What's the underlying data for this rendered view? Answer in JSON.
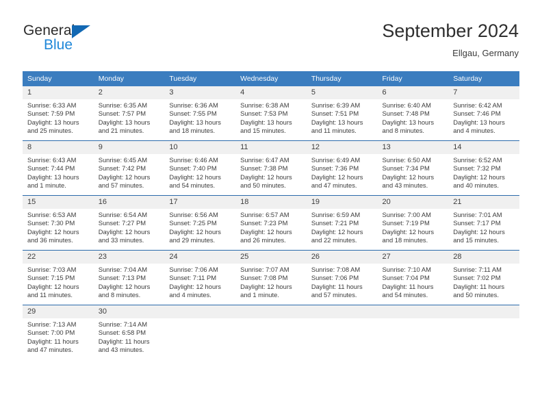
{
  "brand": {
    "name_part1": "General",
    "name_part2": "Blue",
    "triangle_color": "#1268b3",
    "blue_text_color": "#1f87d8"
  },
  "header": {
    "title": "September 2024",
    "location": "Ellgau, Germany"
  },
  "theme": {
    "header_blue": "#3b7dbf",
    "row_divider": "#2a6aab",
    "daynum_band": "#f0f0f0"
  },
  "weekdays": [
    "Sunday",
    "Monday",
    "Tuesday",
    "Wednesday",
    "Thursday",
    "Friday",
    "Saturday"
  ],
  "labels": {
    "sunrise_prefix": "Sunrise:",
    "sunset_prefix": "Sunset:",
    "daylight_prefix": "Daylight:"
  },
  "weeks": [
    [
      {
        "day": "1",
        "sunrise": "Sunrise: 6:33 AM",
        "sunset": "Sunset: 7:59 PM",
        "daylight_line1": "Daylight: 13 hours",
        "daylight_line2": "and 25 minutes."
      },
      {
        "day": "2",
        "sunrise": "Sunrise: 6:35 AM",
        "sunset": "Sunset: 7:57 PM",
        "daylight_line1": "Daylight: 13 hours",
        "daylight_line2": "and 21 minutes."
      },
      {
        "day": "3",
        "sunrise": "Sunrise: 6:36 AM",
        "sunset": "Sunset: 7:55 PM",
        "daylight_line1": "Daylight: 13 hours",
        "daylight_line2": "and 18 minutes."
      },
      {
        "day": "4",
        "sunrise": "Sunrise: 6:38 AM",
        "sunset": "Sunset: 7:53 PM",
        "daylight_line1": "Daylight: 13 hours",
        "daylight_line2": "and 15 minutes."
      },
      {
        "day": "5",
        "sunrise": "Sunrise: 6:39 AM",
        "sunset": "Sunset: 7:51 PM",
        "daylight_line1": "Daylight: 13 hours",
        "daylight_line2": "and 11 minutes."
      },
      {
        "day": "6",
        "sunrise": "Sunrise: 6:40 AM",
        "sunset": "Sunset: 7:48 PM",
        "daylight_line1": "Daylight: 13 hours",
        "daylight_line2": "and 8 minutes."
      },
      {
        "day": "7",
        "sunrise": "Sunrise: 6:42 AM",
        "sunset": "Sunset: 7:46 PM",
        "daylight_line1": "Daylight: 13 hours",
        "daylight_line2": "and 4 minutes."
      }
    ],
    [
      {
        "day": "8",
        "sunrise": "Sunrise: 6:43 AM",
        "sunset": "Sunset: 7:44 PM",
        "daylight_line1": "Daylight: 13 hours",
        "daylight_line2": "and 1 minute."
      },
      {
        "day": "9",
        "sunrise": "Sunrise: 6:45 AM",
        "sunset": "Sunset: 7:42 PM",
        "daylight_line1": "Daylight: 12 hours",
        "daylight_line2": "and 57 minutes."
      },
      {
        "day": "10",
        "sunrise": "Sunrise: 6:46 AM",
        "sunset": "Sunset: 7:40 PM",
        "daylight_line1": "Daylight: 12 hours",
        "daylight_line2": "and 54 minutes."
      },
      {
        "day": "11",
        "sunrise": "Sunrise: 6:47 AM",
        "sunset": "Sunset: 7:38 PM",
        "daylight_line1": "Daylight: 12 hours",
        "daylight_line2": "and 50 minutes."
      },
      {
        "day": "12",
        "sunrise": "Sunrise: 6:49 AM",
        "sunset": "Sunset: 7:36 PM",
        "daylight_line1": "Daylight: 12 hours",
        "daylight_line2": "and 47 minutes."
      },
      {
        "day": "13",
        "sunrise": "Sunrise: 6:50 AM",
        "sunset": "Sunset: 7:34 PM",
        "daylight_line1": "Daylight: 12 hours",
        "daylight_line2": "and 43 minutes."
      },
      {
        "day": "14",
        "sunrise": "Sunrise: 6:52 AM",
        "sunset": "Sunset: 7:32 PM",
        "daylight_line1": "Daylight: 12 hours",
        "daylight_line2": "and 40 minutes."
      }
    ],
    [
      {
        "day": "15",
        "sunrise": "Sunrise: 6:53 AM",
        "sunset": "Sunset: 7:30 PM",
        "daylight_line1": "Daylight: 12 hours",
        "daylight_line2": "and 36 minutes."
      },
      {
        "day": "16",
        "sunrise": "Sunrise: 6:54 AM",
        "sunset": "Sunset: 7:27 PM",
        "daylight_line1": "Daylight: 12 hours",
        "daylight_line2": "and 33 minutes."
      },
      {
        "day": "17",
        "sunrise": "Sunrise: 6:56 AM",
        "sunset": "Sunset: 7:25 PM",
        "daylight_line1": "Daylight: 12 hours",
        "daylight_line2": "and 29 minutes."
      },
      {
        "day": "18",
        "sunrise": "Sunrise: 6:57 AM",
        "sunset": "Sunset: 7:23 PM",
        "daylight_line1": "Daylight: 12 hours",
        "daylight_line2": "and 26 minutes."
      },
      {
        "day": "19",
        "sunrise": "Sunrise: 6:59 AM",
        "sunset": "Sunset: 7:21 PM",
        "daylight_line1": "Daylight: 12 hours",
        "daylight_line2": "and 22 minutes."
      },
      {
        "day": "20",
        "sunrise": "Sunrise: 7:00 AM",
        "sunset": "Sunset: 7:19 PM",
        "daylight_line1": "Daylight: 12 hours",
        "daylight_line2": "and 18 minutes."
      },
      {
        "day": "21",
        "sunrise": "Sunrise: 7:01 AM",
        "sunset": "Sunset: 7:17 PM",
        "daylight_line1": "Daylight: 12 hours",
        "daylight_line2": "and 15 minutes."
      }
    ],
    [
      {
        "day": "22",
        "sunrise": "Sunrise: 7:03 AM",
        "sunset": "Sunset: 7:15 PM",
        "daylight_line1": "Daylight: 12 hours",
        "daylight_line2": "and 11 minutes."
      },
      {
        "day": "23",
        "sunrise": "Sunrise: 7:04 AM",
        "sunset": "Sunset: 7:13 PM",
        "daylight_line1": "Daylight: 12 hours",
        "daylight_line2": "and 8 minutes."
      },
      {
        "day": "24",
        "sunrise": "Sunrise: 7:06 AM",
        "sunset": "Sunset: 7:11 PM",
        "daylight_line1": "Daylight: 12 hours",
        "daylight_line2": "and 4 minutes."
      },
      {
        "day": "25",
        "sunrise": "Sunrise: 7:07 AM",
        "sunset": "Sunset: 7:08 PM",
        "daylight_line1": "Daylight: 12 hours",
        "daylight_line2": "and 1 minute."
      },
      {
        "day": "26",
        "sunrise": "Sunrise: 7:08 AM",
        "sunset": "Sunset: 7:06 PM",
        "daylight_line1": "Daylight: 11 hours",
        "daylight_line2": "and 57 minutes."
      },
      {
        "day": "27",
        "sunrise": "Sunrise: 7:10 AM",
        "sunset": "Sunset: 7:04 PM",
        "daylight_line1": "Daylight: 11 hours",
        "daylight_line2": "and 54 minutes."
      },
      {
        "day": "28",
        "sunrise": "Sunrise: 7:11 AM",
        "sunset": "Sunset: 7:02 PM",
        "daylight_line1": "Daylight: 11 hours",
        "daylight_line2": "and 50 minutes."
      }
    ],
    [
      {
        "day": "29",
        "sunrise": "Sunrise: 7:13 AM",
        "sunset": "Sunset: 7:00 PM",
        "daylight_line1": "Daylight: 11 hours",
        "daylight_line2": "and 47 minutes."
      },
      {
        "day": "30",
        "sunrise": "Sunrise: 7:14 AM",
        "sunset": "Sunset: 6:58 PM",
        "daylight_line1": "Daylight: 11 hours",
        "daylight_line2": "and 43 minutes."
      },
      {
        "day": "",
        "sunrise": "",
        "sunset": "",
        "daylight_line1": "",
        "daylight_line2": ""
      },
      {
        "day": "",
        "sunrise": "",
        "sunset": "",
        "daylight_line1": "",
        "daylight_line2": ""
      },
      {
        "day": "",
        "sunrise": "",
        "sunset": "",
        "daylight_line1": "",
        "daylight_line2": ""
      },
      {
        "day": "",
        "sunrise": "",
        "sunset": "",
        "daylight_line1": "",
        "daylight_line2": ""
      },
      {
        "day": "",
        "sunrise": "",
        "sunset": "",
        "daylight_line1": "",
        "daylight_line2": ""
      }
    ]
  ]
}
